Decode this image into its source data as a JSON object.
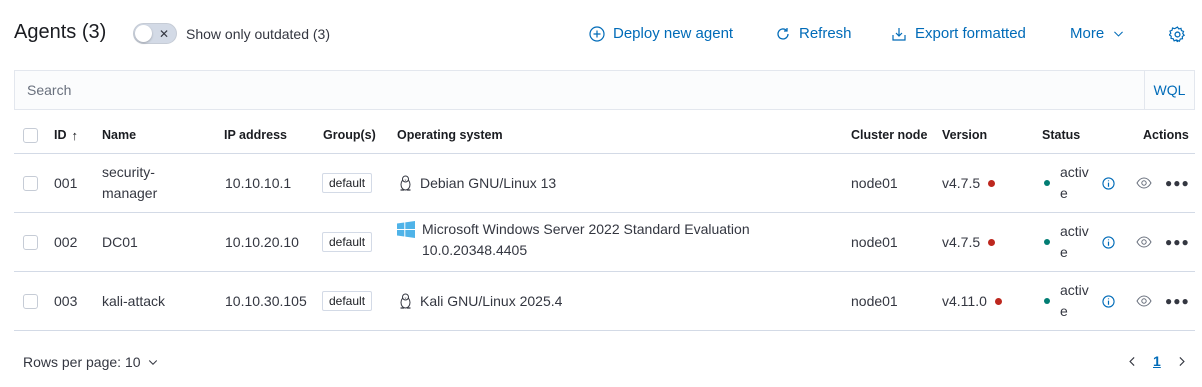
{
  "header": {
    "title": "Agents (3)",
    "outdated_toggle_label": "Show only outdated (3)",
    "deploy_label": "Deploy new agent",
    "refresh_label": "Refresh",
    "export_label": "Export formatted",
    "more_label": "More"
  },
  "search": {
    "placeholder": "Search",
    "value": "",
    "wql_label": "WQL"
  },
  "table": {
    "columns": {
      "id": "ID",
      "name": "Name",
      "ip": "IP address",
      "groups": "Group(s)",
      "os": "Operating system",
      "cluster": "Cluster node",
      "version": "Version",
      "status": "Status",
      "actions": "Actions"
    },
    "rows": [
      {
        "id": "001",
        "name": "security-manager",
        "ip": "10.10.10.1",
        "group": "default",
        "os_icon": "linux-penguin-icon",
        "os": "Debian GNU/Linux 13",
        "cluster": "node01",
        "version": "v4.7.5",
        "status": "active"
      },
      {
        "id": "002",
        "name": "DC01",
        "ip": "10.10.20.10",
        "group": "default",
        "os_icon": "windows-icon",
        "os": "Microsoft Windows Server 2022 Standard Evaluation 10.0.20348.4405",
        "cluster": "node01",
        "version": "v4.7.5",
        "status": "active"
      },
      {
        "id": "003",
        "name": "kali-attack",
        "ip": "10.10.30.105",
        "group": "default",
        "os_icon": "linux-penguin-icon",
        "os": "Kali GNU/Linux 2025.4",
        "cluster": "node01",
        "version": "v4.11.0",
        "status": "active"
      }
    ]
  },
  "footer": {
    "rows_per_page": "Rows per page: 10",
    "current_page": "1"
  },
  "colors": {
    "accent": "#006bb8",
    "outdated_dot": "#bd271e",
    "active_dot": "#017d73",
    "border": "#d3dae6"
  }
}
